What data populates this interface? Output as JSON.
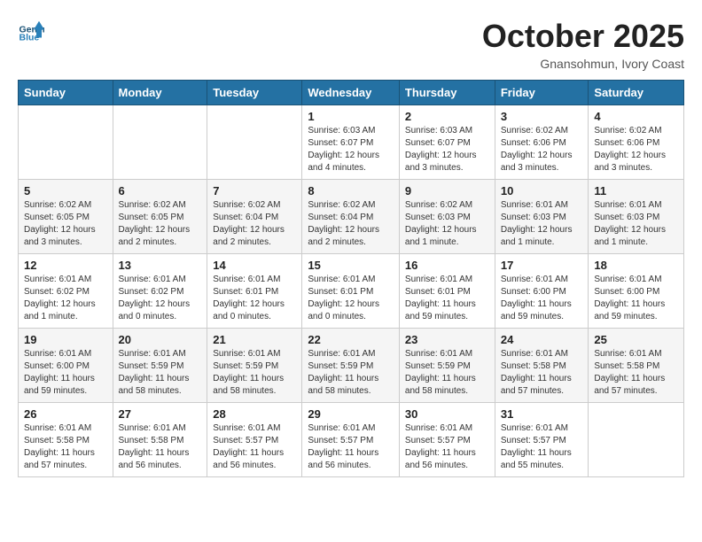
{
  "header": {
    "logo_general": "General",
    "logo_blue": "Blue",
    "month_title": "October 2025",
    "subtitle": "Gnansohmun, Ivory Coast"
  },
  "weekdays": [
    "Sunday",
    "Monday",
    "Tuesday",
    "Wednesday",
    "Thursday",
    "Friday",
    "Saturday"
  ],
  "weeks": [
    [
      {
        "day": "",
        "info": ""
      },
      {
        "day": "",
        "info": ""
      },
      {
        "day": "",
        "info": ""
      },
      {
        "day": "1",
        "info": "Sunrise: 6:03 AM\nSunset: 6:07 PM\nDaylight: 12 hours\nand 4 minutes."
      },
      {
        "day": "2",
        "info": "Sunrise: 6:03 AM\nSunset: 6:07 PM\nDaylight: 12 hours\nand 3 minutes."
      },
      {
        "day": "3",
        "info": "Sunrise: 6:02 AM\nSunset: 6:06 PM\nDaylight: 12 hours\nand 3 minutes."
      },
      {
        "day": "4",
        "info": "Sunrise: 6:02 AM\nSunset: 6:06 PM\nDaylight: 12 hours\nand 3 minutes."
      }
    ],
    [
      {
        "day": "5",
        "info": "Sunrise: 6:02 AM\nSunset: 6:05 PM\nDaylight: 12 hours\nand 3 minutes."
      },
      {
        "day": "6",
        "info": "Sunrise: 6:02 AM\nSunset: 6:05 PM\nDaylight: 12 hours\nand 2 minutes."
      },
      {
        "day": "7",
        "info": "Sunrise: 6:02 AM\nSunset: 6:04 PM\nDaylight: 12 hours\nand 2 minutes."
      },
      {
        "day": "8",
        "info": "Sunrise: 6:02 AM\nSunset: 6:04 PM\nDaylight: 12 hours\nand 2 minutes."
      },
      {
        "day": "9",
        "info": "Sunrise: 6:02 AM\nSunset: 6:03 PM\nDaylight: 12 hours\nand 1 minute."
      },
      {
        "day": "10",
        "info": "Sunrise: 6:01 AM\nSunset: 6:03 PM\nDaylight: 12 hours\nand 1 minute."
      },
      {
        "day": "11",
        "info": "Sunrise: 6:01 AM\nSunset: 6:03 PM\nDaylight: 12 hours\nand 1 minute."
      }
    ],
    [
      {
        "day": "12",
        "info": "Sunrise: 6:01 AM\nSunset: 6:02 PM\nDaylight: 12 hours\nand 1 minute."
      },
      {
        "day": "13",
        "info": "Sunrise: 6:01 AM\nSunset: 6:02 PM\nDaylight: 12 hours\nand 0 minutes."
      },
      {
        "day": "14",
        "info": "Sunrise: 6:01 AM\nSunset: 6:01 PM\nDaylight: 12 hours\nand 0 minutes."
      },
      {
        "day": "15",
        "info": "Sunrise: 6:01 AM\nSunset: 6:01 PM\nDaylight: 12 hours\nand 0 minutes."
      },
      {
        "day": "16",
        "info": "Sunrise: 6:01 AM\nSunset: 6:01 PM\nDaylight: 11 hours\nand 59 minutes."
      },
      {
        "day": "17",
        "info": "Sunrise: 6:01 AM\nSunset: 6:00 PM\nDaylight: 11 hours\nand 59 minutes."
      },
      {
        "day": "18",
        "info": "Sunrise: 6:01 AM\nSunset: 6:00 PM\nDaylight: 11 hours\nand 59 minutes."
      }
    ],
    [
      {
        "day": "19",
        "info": "Sunrise: 6:01 AM\nSunset: 6:00 PM\nDaylight: 11 hours\nand 59 minutes."
      },
      {
        "day": "20",
        "info": "Sunrise: 6:01 AM\nSunset: 5:59 PM\nDaylight: 11 hours\nand 58 minutes."
      },
      {
        "day": "21",
        "info": "Sunrise: 6:01 AM\nSunset: 5:59 PM\nDaylight: 11 hours\nand 58 minutes."
      },
      {
        "day": "22",
        "info": "Sunrise: 6:01 AM\nSunset: 5:59 PM\nDaylight: 11 hours\nand 58 minutes."
      },
      {
        "day": "23",
        "info": "Sunrise: 6:01 AM\nSunset: 5:59 PM\nDaylight: 11 hours\nand 58 minutes."
      },
      {
        "day": "24",
        "info": "Sunrise: 6:01 AM\nSunset: 5:58 PM\nDaylight: 11 hours\nand 57 minutes."
      },
      {
        "day": "25",
        "info": "Sunrise: 6:01 AM\nSunset: 5:58 PM\nDaylight: 11 hours\nand 57 minutes."
      }
    ],
    [
      {
        "day": "26",
        "info": "Sunrise: 6:01 AM\nSunset: 5:58 PM\nDaylight: 11 hours\nand 57 minutes."
      },
      {
        "day": "27",
        "info": "Sunrise: 6:01 AM\nSunset: 5:58 PM\nDaylight: 11 hours\nand 56 minutes."
      },
      {
        "day": "28",
        "info": "Sunrise: 6:01 AM\nSunset: 5:57 PM\nDaylight: 11 hours\nand 56 minutes."
      },
      {
        "day": "29",
        "info": "Sunrise: 6:01 AM\nSunset: 5:57 PM\nDaylight: 11 hours\nand 56 minutes."
      },
      {
        "day": "30",
        "info": "Sunrise: 6:01 AM\nSunset: 5:57 PM\nDaylight: 11 hours\nand 56 minutes."
      },
      {
        "day": "31",
        "info": "Sunrise: 6:01 AM\nSunset: 5:57 PM\nDaylight: 11 hours\nand 55 minutes."
      },
      {
        "day": "",
        "info": ""
      }
    ]
  ]
}
